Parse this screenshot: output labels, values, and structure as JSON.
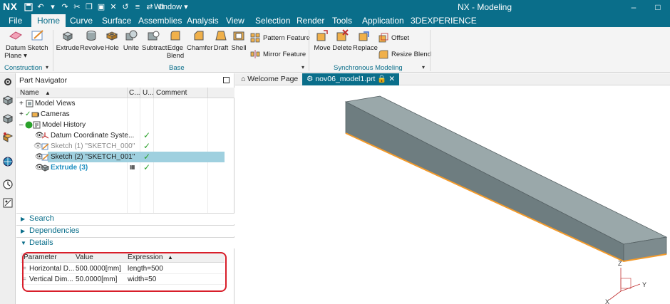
{
  "app": {
    "logo": "NX",
    "window_menu": "Window ▾",
    "title": "NX - Modeling"
  },
  "menu_tabs": [
    "File",
    "Home",
    "Curve",
    "Surface",
    "Assemblies",
    "Analysis",
    "View",
    "Selection",
    "Render",
    "Tools",
    "Application",
    "3DEXPERIENCE"
  ],
  "active_tab": "Home",
  "ribbon": {
    "construction": {
      "label": "Construction",
      "datum_plane_line1": "Datum",
      "datum_plane_line2": "Plane ▾",
      "sketch": "Sketch"
    },
    "base": {
      "label": "Base",
      "buttons": [
        "Extrude",
        "Revolve",
        "Hole",
        "Unite",
        "Subtract",
        "Edge",
        "Chamfer",
        "Draft",
        "Shell"
      ],
      "edge_blend_line2": "Blend",
      "pattern_feature": "Pattern Feature",
      "mirror_feature": "Mirror Feature"
    },
    "sync": {
      "label": "Synchronous Modeling",
      "buttons": [
        "Move",
        "Delete",
        "Replace"
      ],
      "offset": "Offset",
      "resize_blend": "Resize Blend"
    }
  },
  "navigator": {
    "title": "Part Navigator",
    "columns": {
      "name": "Name",
      "c": "C...",
      "u": "U...",
      "comment": "Comment"
    },
    "rows": [
      {
        "label": "Model Views"
      },
      {
        "label": "Cameras"
      },
      {
        "label": "Model History"
      },
      {
        "label": "Datum Coordinate Syste..."
      },
      {
        "label": "Sketch (1) \"SKETCH_000\""
      },
      {
        "label": "Sketch (2) \"SKETCH_001\""
      },
      {
        "label": "Extrude (3)"
      }
    ],
    "sections": {
      "search": "Search",
      "dependencies": "Dependencies",
      "details": "Details"
    },
    "details": {
      "columns": {
        "parameter": "Parameter",
        "value": "Value",
        "expression": "Expression"
      },
      "rows": [
        {
          "parameter": "Horizontal D...",
          "value": "500.0000[mm]",
          "expression": "length=500"
        },
        {
          "parameter": "Vertical Dim...",
          "value": "50.0000[mm]",
          "expression": "width=50"
        }
      ]
    }
  },
  "graphics": {
    "tabs": [
      "Welcome Page",
      "nov06_model1.prt"
    ],
    "triad": {
      "x": "X",
      "y": "Y",
      "z": "Z"
    }
  },
  "colors": {
    "accent": "#0a6e8a",
    "selection": "#9fd0df",
    "check": "#2aa12a",
    "annotation": "#d81e2a",
    "box_top": "#9aa8aa",
    "box_front": "#6e7d80",
    "box_edge": "#f39a2a"
  }
}
